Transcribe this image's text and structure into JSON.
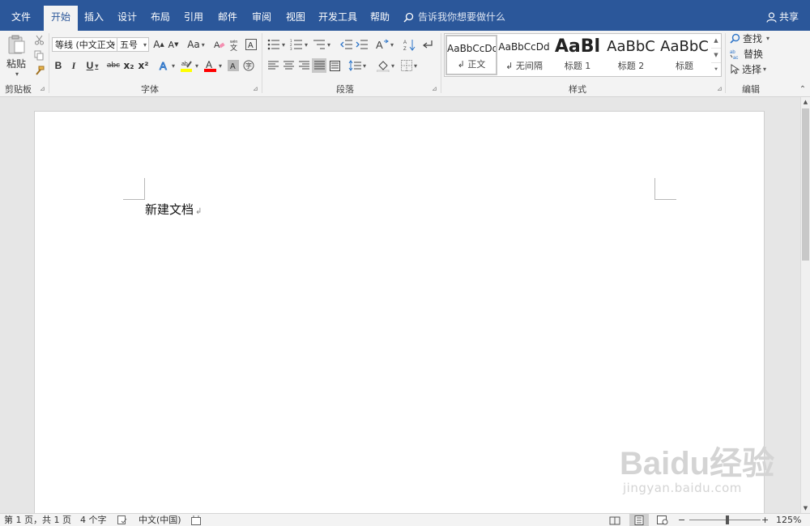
{
  "tabs": [
    {
      "label": "文件",
      "active": false
    },
    {
      "label": "开始",
      "active": true
    },
    {
      "label": "插入",
      "active": false
    },
    {
      "label": "设计",
      "active": false
    },
    {
      "label": "布局",
      "active": false
    },
    {
      "label": "引用",
      "active": false
    },
    {
      "label": "邮件",
      "active": false
    },
    {
      "label": "审阅",
      "active": false
    },
    {
      "label": "视图",
      "active": false
    },
    {
      "label": "开发工具",
      "active": false
    },
    {
      "label": "帮助",
      "active": false
    }
  ],
  "tell_me": {
    "placeholder": "告诉我你想要做什么",
    "icon": "lightbulb-search-icon"
  },
  "share": {
    "label": "共享",
    "icon": "person-icon"
  },
  "clipboard": {
    "paste_label": "粘贴",
    "group_label": "剪贴板"
  },
  "font": {
    "font_name": "等线 (中文正文",
    "font_size": "五号",
    "group_label": "字体",
    "grow_label": "A",
    "shrink_label": "A",
    "case_label": "Aa",
    "bold_label": "B",
    "italic_label": "I",
    "underline_label": "U",
    "strike_label": "abc",
    "sub_label": "x₂",
    "super_label": "x²",
    "highlight_color": "#ffff00",
    "font_color": "#ff0000"
  },
  "paragraph": {
    "group_label": "段落"
  },
  "styles": {
    "group_label": "样式",
    "items": [
      {
        "sample": "AaBbCcDd",
        "name": "正文",
        "selected": true
      },
      {
        "sample": "AaBbCcDd",
        "name": "无间隔",
        "selected": false
      },
      {
        "sample": "AaBl",
        "name": "标题 1",
        "selected": false
      },
      {
        "sample": "AaBbC",
        "name": "标题 2",
        "selected": false
      },
      {
        "sample": "AaBbC",
        "name": "标题",
        "selected": false
      }
    ]
  },
  "editing": {
    "group_label": "编辑",
    "find_label": "查找",
    "replace_label": "替换",
    "select_label": "选择"
  },
  "document": {
    "text": "新建文档"
  },
  "watermark": {
    "logo": "Baidu经验",
    "url": "jingyan.baidu.com"
  },
  "status": {
    "page": "第 1 页，共 1 页",
    "words": "4 个字",
    "language": "中文(中国)",
    "zoom": "125%",
    "zoom_value": 125
  }
}
